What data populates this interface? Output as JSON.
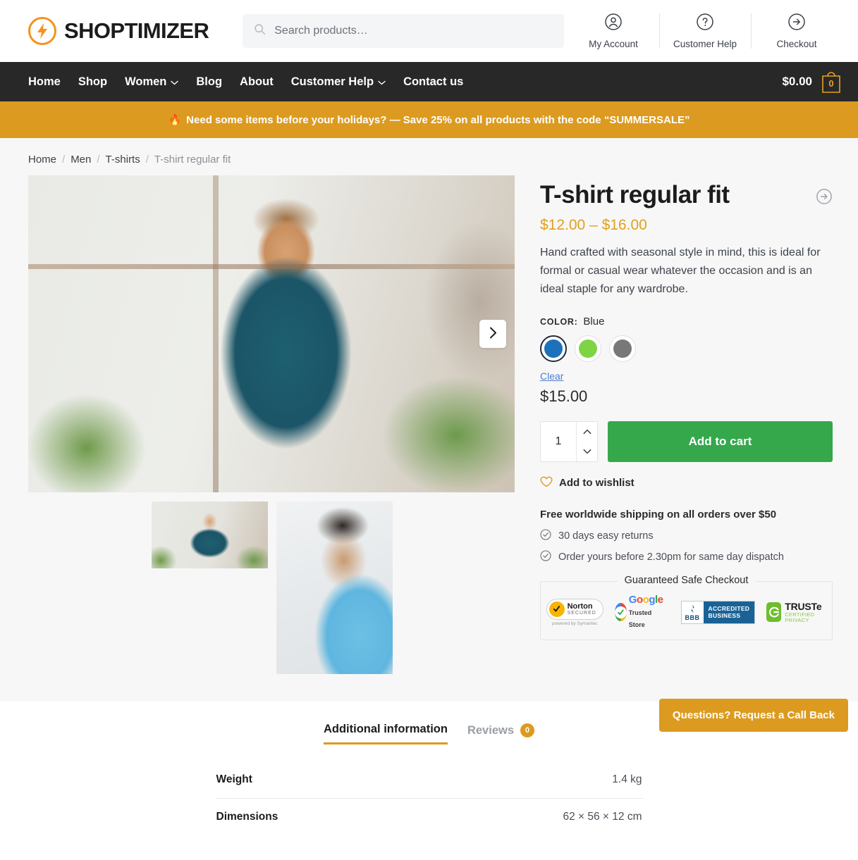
{
  "header": {
    "brand": "SHOPTIMIZER",
    "search": {
      "placeholder": "Search products…",
      "value": ""
    },
    "actions": [
      {
        "label": "My Account",
        "icon": "user-circle-icon"
      },
      {
        "label": "Customer Help",
        "icon": "question-circle-icon"
      },
      {
        "label": "Checkout",
        "icon": "arrow-right-circle-icon"
      }
    ]
  },
  "nav": {
    "items": [
      {
        "label": "Home",
        "has_dropdown": false
      },
      {
        "label": "Shop",
        "has_dropdown": false
      },
      {
        "label": "Women",
        "has_dropdown": true
      },
      {
        "label": "Blog",
        "has_dropdown": false
      },
      {
        "label": "About",
        "has_dropdown": false
      },
      {
        "label": "Customer Help",
        "has_dropdown": true
      },
      {
        "label": "Contact us",
        "has_dropdown": false
      }
    ],
    "cart": {
      "total": "$0.00",
      "count": "0"
    }
  },
  "promo": {
    "emoji": "🔥",
    "text": "Need some items before your holidays? — Save 25% on all products with the code “SUMMERSALE”"
  },
  "breadcrumb": {
    "items": [
      "Home",
      "Men",
      "T-shirts"
    ],
    "current": "T-shirt regular fit"
  },
  "product": {
    "title": "T-shirt regular fit",
    "price_range": "$12.00 – $16.00",
    "description": "Hand crafted with seasonal style in mind, this is ideal for formal or casual wear whatever the occasion and is an ideal staple for any wardrobe.",
    "color_label": "COLOR:",
    "color_value": "Blue",
    "swatches": [
      {
        "name": "Blue",
        "hex": "#1c71bc",
        "selected": true
      },
      {
        "name": "Green",
        "hex": "#7ed444",
        "selected": false
      },
      {
        "name": "Grey",
        "hex": "#787878",
        "selected": false
      }
    ],
    "clear_label": "Clear",
    "selected_price": "$15.00",
    "quantity": "1",
    "add_to_cart_label": "Add to cart",
    "wishlist_label": "Add to wishlist",
    "shipping_heading": "Free worldwide shipping on all orders over $50",
    "shipping_points": [
      "30 days easy returns",
      "Order yours before 2.30pm for same day dispatch"
    ],
    "safe_checkout_title": "Guaranteed Safe Checkout",
    "trust_badges": [
      {
        "name": "Norton",
        "line1": "Norton",
        "line2": "SECURED",
        "line3": "powered by Symantec"
      },
      {
        "name": "Google Trusted Store",
        "line1": "Google",
        "line2": "Trusted Store"
      },
      {
        "name": "BBB",
        "line1": "BBB",
        "line2": "ACCREDITED",
        "line3": "BUSINESS"
      },
      {
        "name": "TRUSTe",
        "line1": "TRUSTe",
        "line2": "CERTIFIED PRIVACY"
      }
    ],
    "next_slide_icon": "chevron-right-icon",
    "title_arrow_icon": "arrow-right-circle-icon"
  },
  "tabs": {
    "items": [
      {
        "label": "Additional information",
        "active": true,
        "badge": ""
      },
      {
        "label": "Reviews",
        "active": false,
        "badge": "0"
      }
    ]
  },
  "additional_information": {
    "rows": [
      {
        "key": "Weight",
        "value": "1.4 kg"
      },
      {
        "key": "Dimensions",
        "value": "62 × 56 × 12 cm"
      }
    ]
  },
  "callback_button": {
    "label": "Questions? Request a Call Back"
  },
  "colors": {
    "accent_orange": "#dc9b20",
    "nav_dark": "#282828",
    "cta_green": "#35a84c",
    "price_orange": "#e0a11c",
    "page_bg": "#f7f7f7"
  }
}
